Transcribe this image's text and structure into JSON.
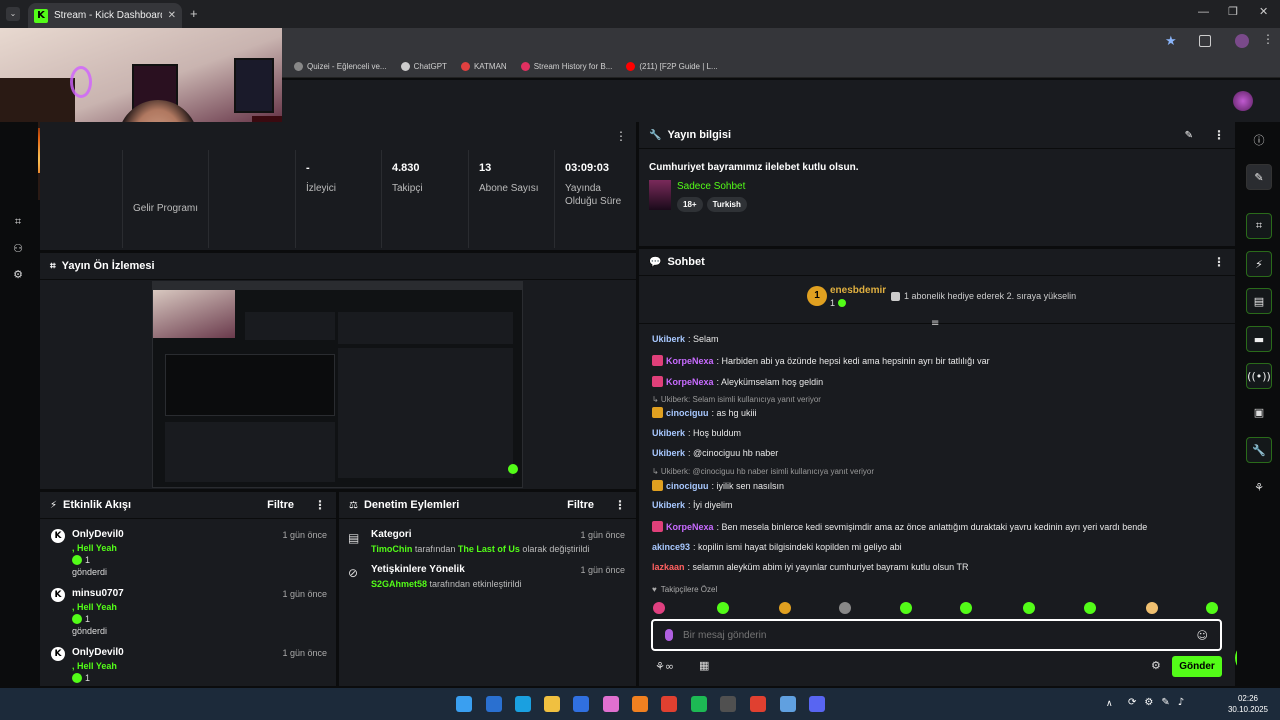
{
  "browser": {
    "tab_title": "Stream - Kick Dashboard",
    "bookmarks": [
      {
        "label": "Quizei - Eğlenceli ve...",
        "color": "#888888"
      },
      {
        "label": "ChatGPT",
        "color": "#cccccc"
      },
      {
        "label": "KATMAN",
        "color": "#e04040"
      },
      {
        "label": "Stream History for B...",
        "color": "#e03060"
      },
      {
        "label": "(211) [F2P Guide | L...",
        "color": "#ff0000"
      }
    ]
  },
  "stats": [
    {
      "value": "",
      "label": "Gelir Programı"
    },
    {
      "value": "-",
      "label": "İzleyici"
    },
    {
      "value": "4.830",
      "label": "Takipçi"
    },
    {
      "value": "13",
      "label": "Abone Sayısı"
    },
    {
      "value": "03:09:03",
      "label": "Yayında Olduğu Süre"
    }
  ],
  "stream_info": {
    "title": "Yayın bilgisi",
    "stream_title": "Cumhuriyet bayramımız ilelebet kutlu olsun.",
    "category": "Sadece Sohbet",
    "tags": [
      "18+",
      "Turkish"
    ]
  },
  "preview": {
    "title": "Yayın Ön İzlemesi"
  },
  "activity": {
    "title": "Etkinlik Akışı",
    "filter": "Filtre",
    "items": [
      {
        "user": "OnlyDevil0",
        "time": "1 gün önce",
        "sub": ", Hell Yeah",
        "count": "1",
        "action": "gönderdi"
      },
      {
        "user": "minsu0707",
        "time": "1 gün önce",
        "sub": ", Hell Yeah",
        "count": "1",
        "action": "gönderdi"
      },
      {
        "user": "OnlyDevil0",
        "time": "1 gün önce",
        "sub": ", Hell Yeah",
        "count": "1",
        "action": ""
      }
    ]
  },
  "moderation": {
    "title": "Denetim Eylemleri",
    "filter": "Filtre",
    "items": [
      {
        "title": "Kategori",
        "time": "1 gün önce",
        "actor": "TimoChin",
        "middle": " tarafından ",
        "target": "The Last of Us",
        "end": " olarak değiştirildi"
      },
      {
        "title": "Yetişkinlere Yönelik",
        "time": "1 gün önce",
        "actor": "S2GAhmet58",
        "middle": " tarafından etkinleştirildi",
        "target": "",
        "end": ""
      }
    ]
  },
  "chat": {
    "title": "Sohbet",
    "pinned_user": "enesbdemir",
    "pinned_count": "1",
    "pinned_text": "1 abonelik hediye ederek 2. sıraya yükselin",
    "messages": [
      {
        "kind": "msg",
        "user": "Ukiberk",
        "color": "#a8c8ff",
        "badge": "",
        "text": ": Selam"
      },
      {
        "kind": "msg",
        "user": "KorpeNexa",
        "color": "#c86bff",
        "badge": "#e0407a",
        "text": ": Harbiden abi ya özünde hepsi kedi ama hepsinin ayrı bir tatlılığı var"
      },
      {
        "kind": "msg",
        "user": "KorpeNexa",
        "color": "#c86bff",
        "badge": "#e0407a",
        "text": ": Aleykümselam hoş geldin"
      },
      {
        "kind": "reply",
        "text": "↳ Ukiberk: Selam isimli kullanıcıya yanıt veriyor"
      },
      {
        "kind": "msg",
        "user": "cinociguu",
        "color": "#a8c8ff",
        "badge": "#e0a020",
        "text": ": as hg ukiii"
      },
      {
        "kind": "msg",
        "user": "Ukiberk",
        "color": "#a8c8ff",
        "badge": "",
        "text": ": Hoş buldum"
      },
      {
        "kind": "msg",
        "user": "Ukiberk",
        "color": "#a8c8ff",
        "badge": "",
        "text": ": @cinociguu hb naber"
      },
      {
        "kind": "reply",
        "text": "↳ Ukiberk: @cinociguu hb naber isimli kullanıcıya yanıt veriyor"
      },
      {
        "kind": "msg",
        "user": "cinociguu",
        "color": "#a8c8ff",
        "badge": "#e0a020",
        "text": ": iyilik sen nasılsın"
      },
      {
        "kind": "msg",
        "user": "Ukiberk",
        "color": "#a8c8ff",
        "badge": "",
        "text": ": İyi diyelim"
      },
      {
        "kind": "msg",
        "user": "KorpeNexa",
        "color": "#c86bff",
        "badge": "#e0407a",
        "text": ": Ben mesela binlerce kedi sevmişimdir ama az önce anlattığım duraktaki yavru kedinin ayrı yeri vardı bende"
      },
      {
        "kind": "msg",
        "user": "akince93",
        "color": "#a8c8ff",
        "badge": "",
        "text": ": kopilin ismi hayat bilgisindeki kopilden mi geliyo abi"
      },
      {
        "kind": "msg",
        "user": "lazkaan",
        "color": "#ff6060",
        "badge": "",
        "text": ": selamın aleyküm abim iyi yayınlar cumhuriyet bayramı kutlu olsun TR"
      }
    ],
    "followers_label": "Takipçilere Özel",
    "input_placeholder": "Bir mesaj gönderin",
    "send_label": "Gönder"
  },
  "taskbar": {
    "time": "02:26",
    "date": "30.10.2025"
  }
}
